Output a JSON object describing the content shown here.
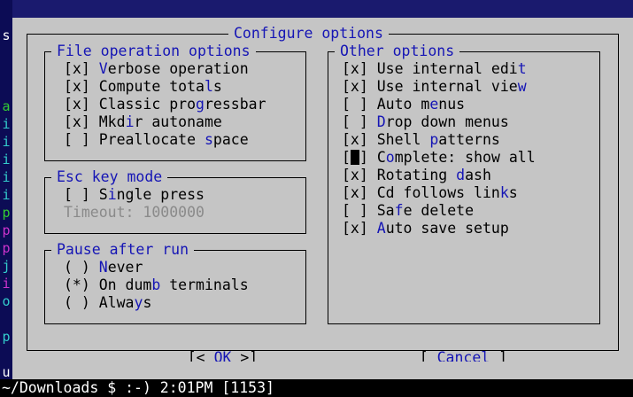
{
  "dialog": {
    "title": "Configure options"
  },
  "file_ops": {
    "title": "File operation options",
    "items": [
      {
        "box": "[x]",
        "pre": "",
        "hot": "V",
        "post": "erbose operation"
      },
      {
        "box": "[x]",
        "pre": "Compute tota",
        "hot": "l",
        "post": "s"
      },
      {
        "box": "[x]",
        "pre": "Classic pro",
        "hot": "g",
        "post": "ressbar"
      },
      {
        "box": "[x]",
        "pre": "Mkd",
        "hot": "i",
        "post": "r autoname"
      },
      {
        "box": "[ ]",
        "pre": "Preallocate ",
        "hot": "s",
        "post": "pace"
      }
    ]
  },
  "esc_mode": {
    "title": "Esc key mode",
    "single_press": {
      "box": "[ ]",
      "pre": "S",
      "hot": "i",
      "post": "ngle press"
    },
    "timeout": "Timeout: 1000000"
  },
  "pause": {
    "title": "Pause after run",
    "items": [
      {
        "radio": "( )",
        "pre": "",
        "hot": "N",
        "post": "ever"
      },
      {
        "radio": "(*)",
        "pre": "On dum",
        "hot": "b",
        "post": " terminals"
      },
      {
        "radio": "( )",
        "pre": "Alwa",
        "hot": "y",
        "post": "s"
      }
    ]
  },
  "other": {
    "title": "Other options",
    "items": [
      {
        "box": "[x]",
        "pre": "Use internal edi",
        "hot": "t",
        "post": ""
      },
      {
        "box": "[x]",
        "pre": "Use internal vie",
        "hot": "w",
        "post": ""
      },
      {
        "box": "[ ]",
        "pre": "Auto m",
        "hot": "e",
        "post": "nus"
      },
      {
        "box": "[ ]",
        "pre": "",
        "hot": "D",
        "post": "rop down menus"
      },
      {
        "box": "[x]",
        "pre": "Shell ",
        "hot": "p",
        "post": "atterns"
      },
      {
        "box": "[",
        "pre": "C",
        "hot": "o",
        "post": "mplete: show all",
        "focused": true
      },
      {
        "box": "[x]",
        "pre": "Rotating ",
        "hot": "d",
        "post": "ash"
      },
      {
        "box": "[x]",
        "pre": "Cd follows lin",
        "hot": "k",
        "post": "s"
      },
      {
        "box": "[ ]",
        "pre": "Sa",
        "hot": "f",
        "post": "e delete"
      },
      {
        "box": "[x]",
        "pre": "",
        "hot": "A",
        "post": "uto save setup"
      }
    ]
  },
  "buttons": {
    "ok_left": "[< ",
    "ok_label": "OK",
    "ok_right": " >]",
    "cancel_left": "[ ",
    "cancel_label": "Cancel",
    "cancel_right": " ]"
  },
  "left_strip": [
    "s",
    "",
    "",
    "",
    "a",
    "i",
    "i",
    "i",
    "i",
    "i",
    "p",
    "p",
    "p",
    "j",
    "i",
    "o",
    "",
    "p",
    "",
    "u"
  ],
  "status": {
    "prompt": "~/Downloads $ :-) 2:01PM [1153]"
  },
  "colors": {
    "dialog_bg": "#c5c5c5",
    "hotkey": "#1515b5",
    "disabled": "#8a8a8a",
    "panel_bg": "#1a1a6e"
  }
}
